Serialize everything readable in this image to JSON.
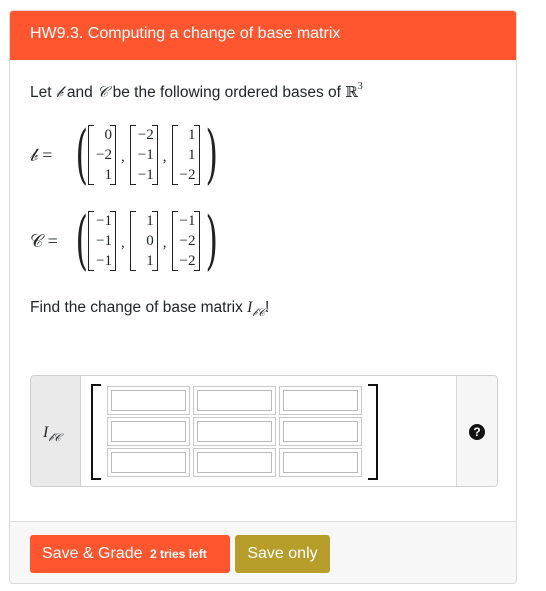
{
  "header": {
    "title": "HW9.3. Computing a change of base matrix"
  },
  "prompt": {
    "text_before": "Let ",
    "B_symbol": "𝒷",
    "and_text": " and ",
    "C_symbol": "𝒞",
    "text_after": " be the following ordered bases of ",
    "R_symbol": "ℝ",
    "R_exponent": "3"
  },
  "basis_B": {
    "label": "𝒷 =",
    "vectors": [
      [
        "0",
        "−2",
        "1"
      ],
      [
        "−2",
        "−1",
        "−1"
      ],
      [
        "1",
        "1",
        "−2"
      ]
    ]
  },
  "basis_C": {
    "label": "𝒞 =",
    "vectors": [
      [
        "−1",
        "−1",
        "−1"
      ],
      [
        "1",
        "0",
        "1"
      ],
      [
        "−1",
        "−2",
        "−2"
      ]
    ]
  },
  "question": {
    "text": "Find the change of base matrix ",
    "I_symbol": "I",
    "I_subscript": "𝒷𝒞",
    "suffix": "!"
  },
  "answer": {
    "label_I": "I",
    "label_sub": "𝒷𝒞",
    "help_icon": "question-circle-icon",
    "cells": [
      "",
      "",
      "",
      "",
      "",
      "",
      "",
      "",
      ""
    ]
  },
  "footer": {
    "save_grade_label": "Save & Grade",
    "tries_label": "2 tries left",
    "save_only_label": "Save only"
  },
  "colors": {
    "accent": "#ff5630",
    "save_only": "#b79d2a"
  }
}
